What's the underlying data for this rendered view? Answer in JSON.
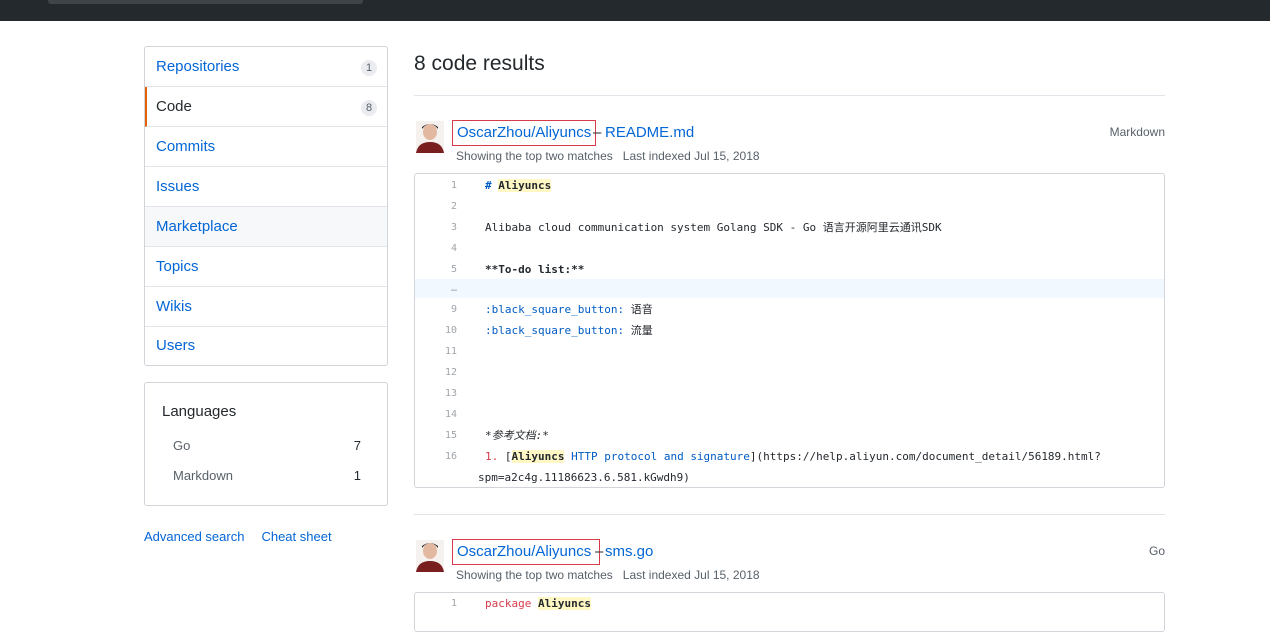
{
  "sidebar": {
    "items": [
      {
        "label": "Repositories",
        "count": "1"
      },
      {
        "label": "Code",
        "count": "8"
      },
      {
        "label": "Commits",
        "count": ""
      },
      {
        "label": "Issues",
        "count": ""
      },
      {
        "label": "Marketplace",
        "count": ""
      },
      {
        "label": "Topics",
        "count": ""
      },
      {
        "label": "Wikis",
        "count": ""
      },
      {
        "label": "Users",
        "count": ""
      }
    ],
    "languages": {
      "title": "Languages",
      "items": [
        {
          "name": "Go",
          "count": "7"
        },
        {
          "name": "Markdown",
          "count": "1"
        }
      ]
    },
    "links": {
      "advanced": "Advanced search",
      "cheat": "Cheat sheet"
    }
  },
  "main": {
    "title": "8 code results",
    "results": [
      {
        "repo": "OscarZhou/Aliyuncs",
        "dash": "–",
        "file": "README.md",
        "language": "Markdown",
        "matches": "Showing the top two matches",
        "indexed": "Last indexed Jul 15, 2018",
        "lines": [
          {
            "n": "1",
            "pre": "# ",
            "hl": "Aliyuncs",
            "post": ""
          },
          {
            "n": "2",
            "text": ""
          },
          {
            "n": "3",
            "text": "Alibaba cloud communication system Golang SDK - Go 语言开源阿里云通讯SDK"
          },
          {
            "n": "4",
            "text": ""
          },
          {
            "n": "5",
            "text": "**To-do list:**"
          },
          {
            "n": "…",
            "text": ""
          },
          {
            "n": "9",
            "key": ":black_square_button:",
            "val": " 语音"
          },
          {
            "n": "10",
            "key": ":black_square_button:",
            "val": " 流量"
          },
          {
            "n": "11",
            "text": ""
          },
          {
            "n": "12",
            "text": ""
          },
          {
            "n": "13",
            "text": ""
          },
          {
            "n": "14",
            "text": ""
          },
          {
            "n": "15",
            "text": "*参考文档:*"
          },
          {
            "n": "16",
            "num": "1.",
            "open": " [",
            "hl": "Aliyuncs",
            "link": " HTTP protocol and signature",
            "close": "](https://help.aliyun.com/document_detail/56189.html?"
          },
          {
            "n": "",
            "text": "spm=a2c4g.11186623.6.581.kGwdh9)"
          }
        ]
      },
      {
        "repo": "OscarZhou/Aliyuncs",
        "dash": "–",
        "file": "sms.go",
        "language": "Go",
        "matches": "Showing the top two matches",
        "indexed": "Last indexed Jul 15, 2018",
        "lines": [
          {
            "n": "1",
            "kw": "package",
            "hl": "Aliyuncs"
          }
        ]
      }
    ]
  },
  "colors": {
    "link": "#0366d6",
    "accent": "#e36209",
    "highlight": "#fff8c5",
    "box": "#d73a49"
  }
}
